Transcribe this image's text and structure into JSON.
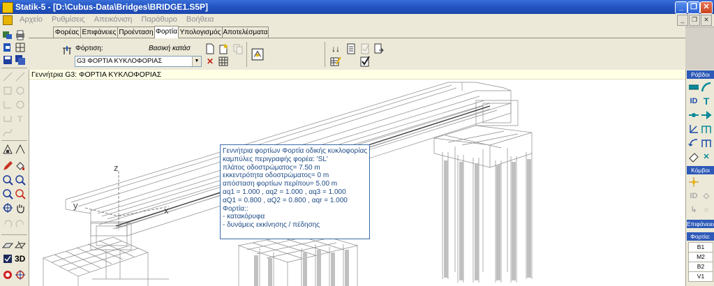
{
  "window": {
    "title": "Statik-5 - [D:\\Cubus-Data\\Bridges\\BRIDGE1.S5P]",
    "controls": [
      "_",
      "❐",
      "✕"
    ]
  },
  "menu": {
    "items": [
      "Αρχείο",
      "Ρυθμίσεις",
      "Απεικόνιση",
      "Παράθυρο",
      "Βοήθεια"
    ],
    "doc_controls": [
      "_",
      "❐",
      "✕"
    ]
  },
  "tabs": [
    "Φορέας",
    "Επιφάνειες",
    "Προένταση",
    "Φορτία",
    "Υπολογισμός",
    "Αποτελέσματα"
  ],
  "active_tab": "Φορτία",
  "loading": {
    "label": "Φόρτιση:",
    "hint": "Βασική κατάσ",
    "selected": "G3  ΦΟΡΤΙΑ ΚΥΚΛΟΦΟΡΙΑΣ"
  },
  "status_text": "Γεννήτρια G3: ΦΟΡΤΙΑ ΚΥΚΛΟΦΟΡΙΑΣ",
  "tooltip_lines": [
    "Γεννήτρια φορτίων Φορτία οδικής κυκλοφορίας",
    "καμπύλες περιγραφής φορέα:  'SL'",
    "πλάτος οδοστρώματος= 7.50 m",
    "εκκεντρότητα οδοστρώματος= 0 m",
    "απόσταση φορτίων περίπου= 5.00 m",
    "αq1 = 1.000 ,   αq2 = 1.000 ,   αq3 = 1.000",
    "αQ1 = 0.800 ,   αQ2 = 0.800 ,   αqr = 1.000",
    "Φορτία::",
    "- κατακόρυφα",
    "- δυνάμεις εκκίνησης / πέδησης"
  ],
  "axis_labels": {
    "z": "z",
    "y": "y",
    "x": "x"
  },
  "right_panel": {
    "sections": [
      "Ράβδοι",
      "Κόμβοι",
      "Επιφάνειες",
      "Φορτία:"
    ],
    "load_items": [
      "B1",
      "M2",
      "B2",
      "V1"
    ]
  },
  "left_toolbar": {
    "view3d_label": "3D"
  },
  "colors": {
    "title_bar": "#2456c4",
    "panel_header": "#2d59b8",
    "tooltip_border": "#3a6ca8",
    "status_bg": "#ffffe6"
  }
}
